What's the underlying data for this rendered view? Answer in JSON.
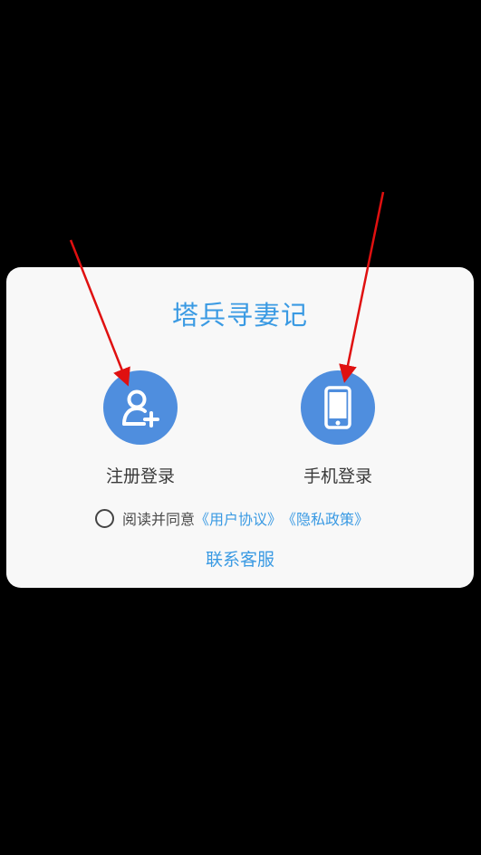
{
  "dialog": {
    "title": "塔兵寻妻记",
    "register": {
      "label": "注册登录",
      "icon": "add-user-icon"
    },
    "phone": {
      "label": "手机登录",
      "icon": "smartphone-icon"
    },
    "agreement": {
      "checked": false,
      "prefix": "阅读并同意",
      "user_agreement": "《用户协议》",
      "privacy_policy": "《隐私政策》"
    },
    "contact_label": "联系客服"
  },
  "colors": {
    "accent": "#3a9ae3",
    "icon_circle": "#4f8ede",
    "annotation_arrow": "#e01010",
    "backdrop": "#000000",
    "dialog_bg": "#f8f8f8"
  }
}
